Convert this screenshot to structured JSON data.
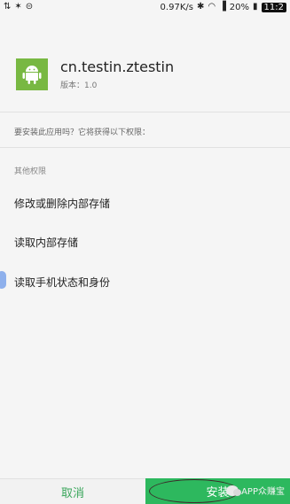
{
  "status_bar": {
    "left_icons": [
      "usb-icon",
      "bug-icon",
      "sync-icon"
    ],
    "speed": "0.97K/s",
    "battery": "20%",
    "time": "11:2"
  },
  "app": {
    "name": "cn.testin.ztestin",
    "version": "版本：1.0",
    "icon_color": "#78b842"
  },
  "prompt": "要安装此应用吗？它将获得以下权限：",
  "permissions": {
    "section_title": "其他权限",
    "items": [
      "修改或删除内部存储",
      "读取内部存储",
      "读取手机状态和身份"
    ]
  },
  "buttons": {
    "cancel": "取消",
    "install": "安装"
  },
  "watermark": "APP众赚宝",
  "colors": {
    "accent": "#2db85e",
    "cancel_text": "#3aa65b"
  }
}
